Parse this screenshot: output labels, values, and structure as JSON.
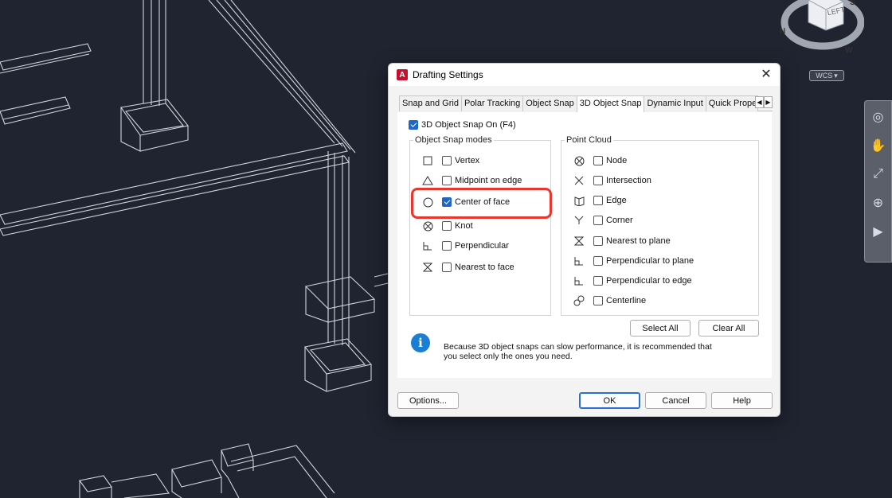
{
  "viewcube": {
    "face_label": "LEFT",
    "compass": [
      "S",
      "N",
      "W"
    ]
  },
  "wcs_label": "WCS",
  "dialog": {
    "title": "Drafting Settings",
    "tabs": [
      "Snap and Grid",
      "Polar Tracking",
      "Object Snap",
      "3D Object Snap",
      "Dynamic Input",
      "Quick Propert"
    ],
    "active_tab": "3D Object Snap",
    "snap_on": {
      "label": "3D Object Snap On (F4)",
      "checked": true
    },
    "object_snap_modes": {
      "title": "Object Snap modes",
      "items": [
        {
          "label": "Vertex",
          "icon": "square-icon",
          "checked": false
        },
        {
          "label": "Midpoint on edge",
          "icon": "triangle-icon",
          "checked": false
        },
        {
          "label": "Center of face",
          "icon": "circle-icon",
          "checked": true
        },
        {
          "label": "Knot",
          "icon": "knot-icon",
          "checked": false
        },
        {
          "label": "Perpendicular",
          "icon": "perpendicular-icon",
          "checked": false
        },
        {
          "label": "Nearest to face",
          "icon": "hourglass-icon",
          "checked": false
        }
      ]
    },
    "point_cloud": {
      "title": "Point Cloud",
      "items": [
        {
          "label": "Node",
          "icon": "node-icon",
          "checked": false
        },
        {
          "label": "Intersection",
          "icon": "x-icon",
          "checked": false
        },
        {
          "label": "Edge",
          "icon": "edge-icon",
          "checked": false
        },
        {
          "label": "Corner",
          "icon": "corner-icon",
          "checked": false
        },
        {
          "label": "Nearest to plane",
          "icon": "hourglass-icon",
          "checked": false
        },
        {
          "label": "Perpendicular to plane",
          "icon": "perpendicular-icon",
          "checked": false
        },
        {
          "label": "Perpendicular to edge",
          "icon": "perpendicular-icon",
          "checked": false
        },
        {
          "label": "Centerline",
          "icon": "centerline-icon",
          "checked": false
        }
      ]
    },
    "select_all": "Select All",
    "clear_all": "Clear All",
    "info_line1": "Because 3D object snaps can slow performance, it is recommended that",
    "info_line2": "you select only the ones you need.",
    "buttons": {
      "options": "Options...",
      "ok": "OK",
      "cancel": "Cancel",
      "help": "Help"
    }
  },
  "colors": {
    "background": "#202430",
    "highlight": "#e8372e",
    "accent": "#1e66c9"
  }
}
